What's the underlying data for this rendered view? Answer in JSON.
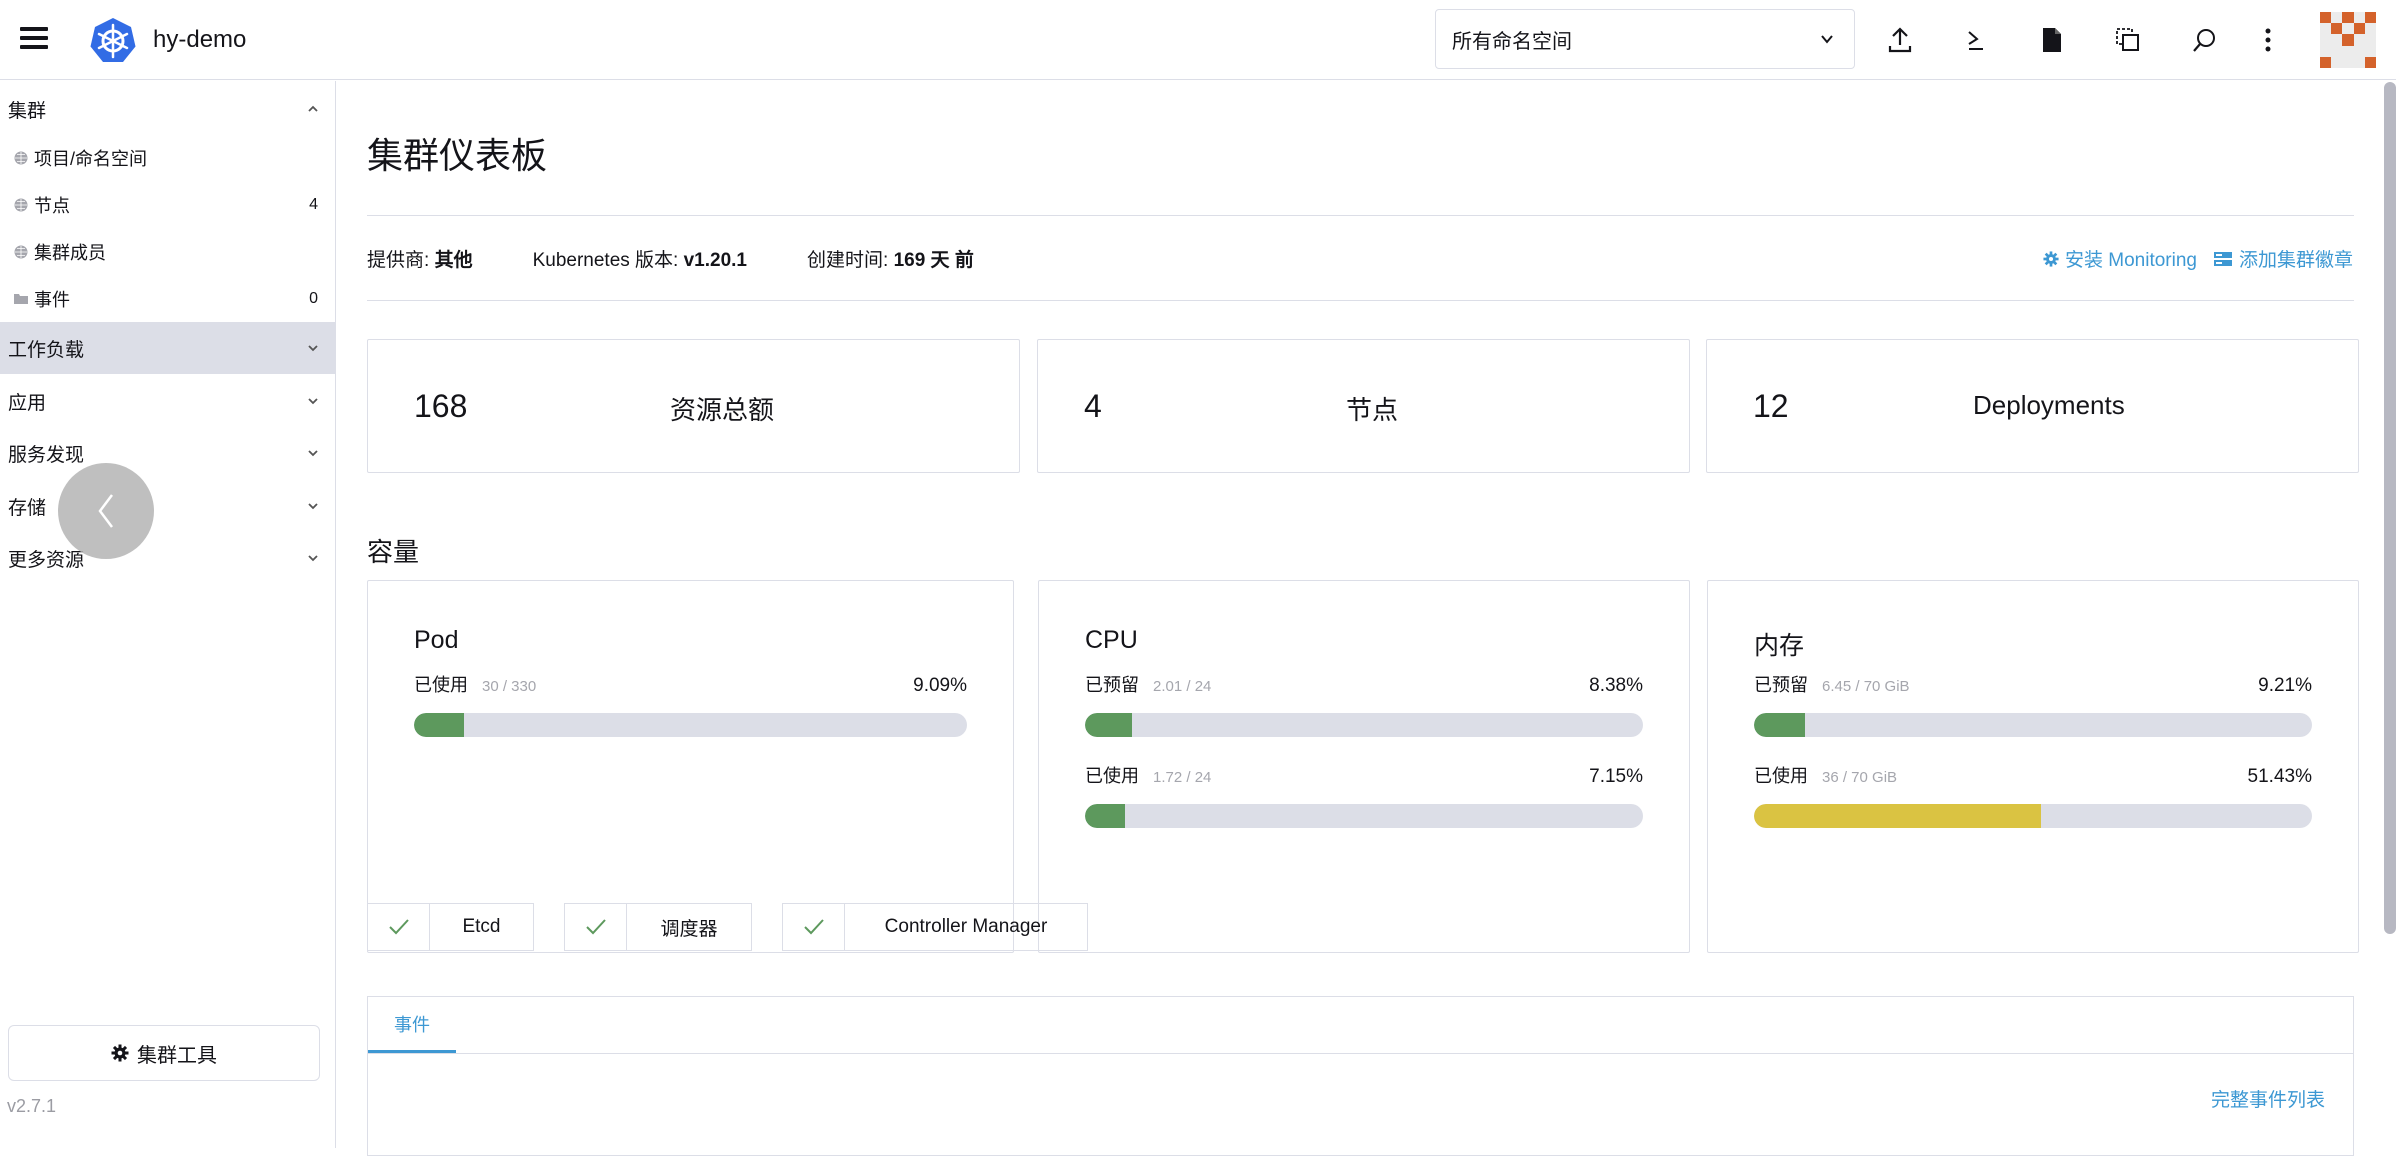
{
  "header": {
    "cluster_name": "hy-demo",
    "namespace_select": {
      "selected": "所有命名空间"
    },
    "icons": [
      "import-yaml-icon",
      "kubectl-shell-icon",
      "kubeconfig-file-icon",
      "copy-kubeconfig-icon",
      "search-icon",
      "more-actions-icon"
    ]
  },
  "sidebar": {
    "groups": [
      {
        "label": "集群",
        "expanded": true,
        "items": [
          {
            "label": "项目/命名空间",
            "count": null,
            "icon": "globe-icon"
          },
          {
            "label": "节点",
            "count": "4",
            "icon": "globe-icon"
          },
          {
            "label": "集群成员",
            "count": null,
            "icon": "globe-icon"
          },
          {
            "label": "事件",
            "count": "0",
            "icon": "folder-icon"
          }
        ]
      },
      {
        "label": "工作负载",
        "expanded": false,
        "active": true
      },
      {
        "label": "应用",
        "expanded": false
      },
      {
        "label": "服务发现",
        "expanded": false
      },
      {
        "label": "存储",
        "expanded": false
      },
      {
        "label": "更多资源",
        "expanded": false
      }
    ],
    "tools_button": "集群工具",
    "version": "v2.7.1"
  },
  "main": {
    "title": "集群仪表板",
    "meta": {
      "provider_label": "提供商:",
      "provider_value": "其他",
      "k8s_label": "Kubernetes 版本:",
      "k8s_value": "v1.20.1",
      "created_label": "创建时间:",
      "created_value": "169 天 前"
    },
    "actions": {
      "install_monitoring": "安装 Monitoring",
      "add_badge": "添加集群徽章"
    },
    "counts": [
      {
        "value": "168",
        "label": "资源总额"
      },
      {
        "value": "4",
        "label": "节点"
      },
      {
        "value": "12",
        "label": "Deployments"
      }
    ],
    "capacity_title": "容量",
    "capacity": [
      {
        "title": "Pod",
        "gauges": [
          {
            "label": "已使用",
            "value": "30 / 330",
            "percent_text": "9.09%",
            "percent": 9.09,
            "color": "#5d995d"
          }
        ]
      },
      {
        "title": "CPU",
        "gauges": [
          {
            "label": "已预留",
            "value": "2.01 / 24",
            "percent_text": "8.38%",
            "percent": 8.38,
            "color": "#5d995d"
          },
          {
            "label": "已使用",
            "value": "1.72 / 24",
            "percent_text": "7.15%",
            "percent": 7.15,
            "color": "#5d995d"
          }
        ]
      },
      {
        "title": "内存",
        "gauges": [
          {
            "label": "已预留",
            "value": "6.45 / 70 GiB",
            "percent_text": "9.21%",
            "percent": 9.21,
            "color": "#5d995d"
          },
          {
            "label": "已使用",
            "value": "36 / 70 GiB",
            "percent_text": "51.43%",
            "percent": 51.43,
            "color": "#dac342"
          }
        ]
      }
    ],
    "components": [
      {
        "label": "Etcd",
        "status": "ok"
      },
      {
        "label": "调度器",
        "status": "ok"
      },
      {
        "label": "Controller Manager",
        "status": "ok"
      }
    ],
    "events": {
      "tab_label": "事件",
      "full_list_link": "完整事件列表"
    }
  },
  "colors": {
    "accent": "#3d98d3",
    "success": "#5d995d",
    "warning": "#dac342",
    "avatar": "#d4622b",
    "k8s_blue": "#326ce5"
  }
}
